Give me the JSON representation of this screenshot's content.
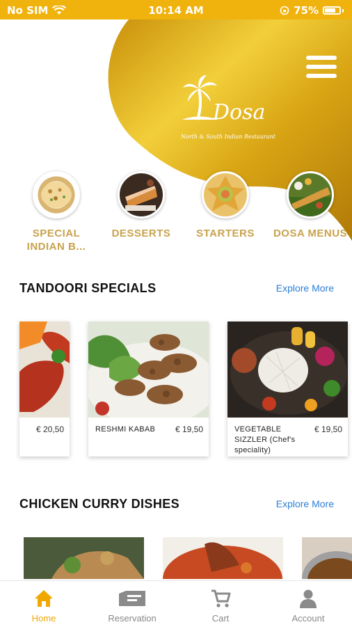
{
  "status_bar": {
    "carrier": "No SIM",
    "time": "10:14 AM",
    "battery": "75%",
    "battery_level": 0.75
  },
  "brand": {
    "name": "Dosa",
    "tagline": "North & South Indian Restaurant"
  },
  "categories": [
    {
      "label": "SPECIAL INDIAN B..."
    },
    {
      "label": "DESSERTS"
    },
    {
      "label": "STARTERS"
    },
    {
      "label": "DOSA MENUS"
    }
  ],
  "sections": [
    {
      "title": "TANDOORI SPECIALS",
      "explore_label": "Explore More",
      "items": [
        {
          "name": "",
          "price": "€ 20,50"
        },
        {
          "name": "RESHMI KABAB",
          "price": "€ 19,50"
        },
        {
          "name": "VEGETABLE SIZZLER (Chef's speciality)",
          "price": "€ 19,50"
        }
      ]
    },
    {
      "title": "CHICKEN CURRY DISHES",
      "explore_label": "Explore More"
    }
  ],
  "tabs": [
    {
      "label": "Home",
      "icon": "home-icon",
      "active": true
    },
    {
      "label": "Reservation",
      "icon": "ticket-icon",
      "active": false
    },
    {
      "label": "Cart",
      "icon": "cart-icon",
      "active": false
    },
    {
      "label": "Account",
      "icon": "user-icon",
      "active": false
    }
  ],
  "colors": {
    "accent": "#f0b20c",
    "category_text": "#c8a24c",
    "link": "#2b7fd9",
    "active_tab": "#f0a800"
  }
}
